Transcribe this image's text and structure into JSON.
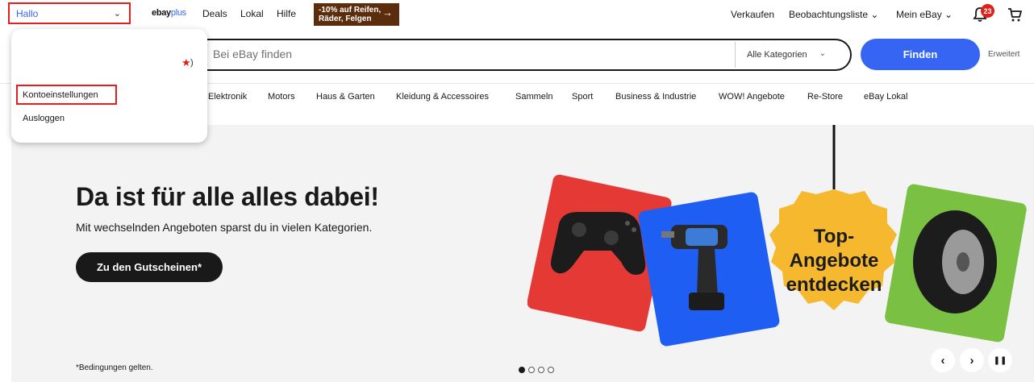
{
  "topbar": {
    "greeting": "Hallo",
    "ebayplus_prefix": "ebay",
    "ebayplus_suffix": "plus",
    "links": [
      "Deals",
      "Lokal",
      "Hilfe"
    ],
    "promo_line1": "-10% auf Reifen,",
    "promo_line2": "Räder, Felgen",
    "promo_arrow": "→",
    "right_links": [
      "Verkaufen",
      "Beobachtungsliste",
      "Mein eBay"
    ],
    "notification_count": "23"
  },
  "account_menu": {
    "items": [
      "Kontoeinstellungen",
      "Ausloggen"
    ],
    "suffix": ")"
  },
  "search": {
    "placeholder": "Bei eBay finden",
    "category": "Alle Kategorien",
    "button": "Finden",
    "advanced": "Erweitert"
  },
  "nav": [
    "Elektronik",
    "Motors",
    "Haus & Garten",
    "Kleidung & Accessoires",
    "Sammeln",
    "Sport",
    "Business & Industrie",
    "WOW! Angebote",
    "Re-Store",
    "eBay Lokal"
  ],
  "hero": {
    "title": "Da ist für alle alles dabei!",
    "subtitle": "Mit wechselnden Angeboten sparst du in vielen Kategorien.",
    "cta": "Zu den Gutscheinen*",
    "terms": "*Bedingungen gelten.",
    "badge_line1": "Top-",
    "badge_line2": "Angebote",
    "badge_line3": "entdecken",
    "slide_count": 4,
    "active_slide": 1,
    "prev_label": "‹",
    "next_label": "›",
    "pause_label": "❚❚"
  },
  "colors": {
    "accent_blue": "#3665f3",
    "highlight_red": "#e0201b",
    "promo_brown": "#5c2d0c",
    "card_red": "#e53935",
    "card_blue": "#1e5ef3",
    "card_green": "#7ac143",
    "badge_yellow": "#f5b82e"
  }
}
